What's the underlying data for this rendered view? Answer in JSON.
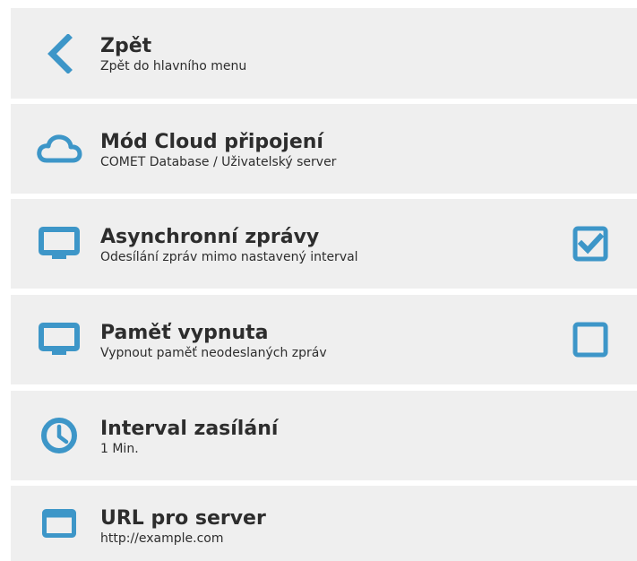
{
  "accent_color": "#3d96c8",
  "menu": {
    "items": [
      {
        "icon": "back-chevron-icon",
        "title": "Zpět",
        "subtitle": "Zpět do hlavního menu"
      },
      {
        "icon": "cloud-icon",
        "title": "Mód Cloud připojení",
        "subtitle": "COMET Database / Uživatelský server"
      },
      {
        "icon": "monitor-icon",
        "title": "Asynchronní zprávy",
        "subtitle": "Odesílání zpráv mimo nastavený interval",
        "checked": true
      },
      {
        "icon": "monitor-icon",
        "title": "Paměť vypnuta",
        "subtitle": "Vypnout paměť neodeslaných zpráv",
        "checked": false
      },
      {
        "icon": "clock-icon",
        "title": "Interval zasílání",
        "subtitle": "1 Min."
      },
      {
        "icon": "window-icon",
        "title": "URL pro server",
        "subtitle": "http://example.com"
      }
    ]
  }
}
